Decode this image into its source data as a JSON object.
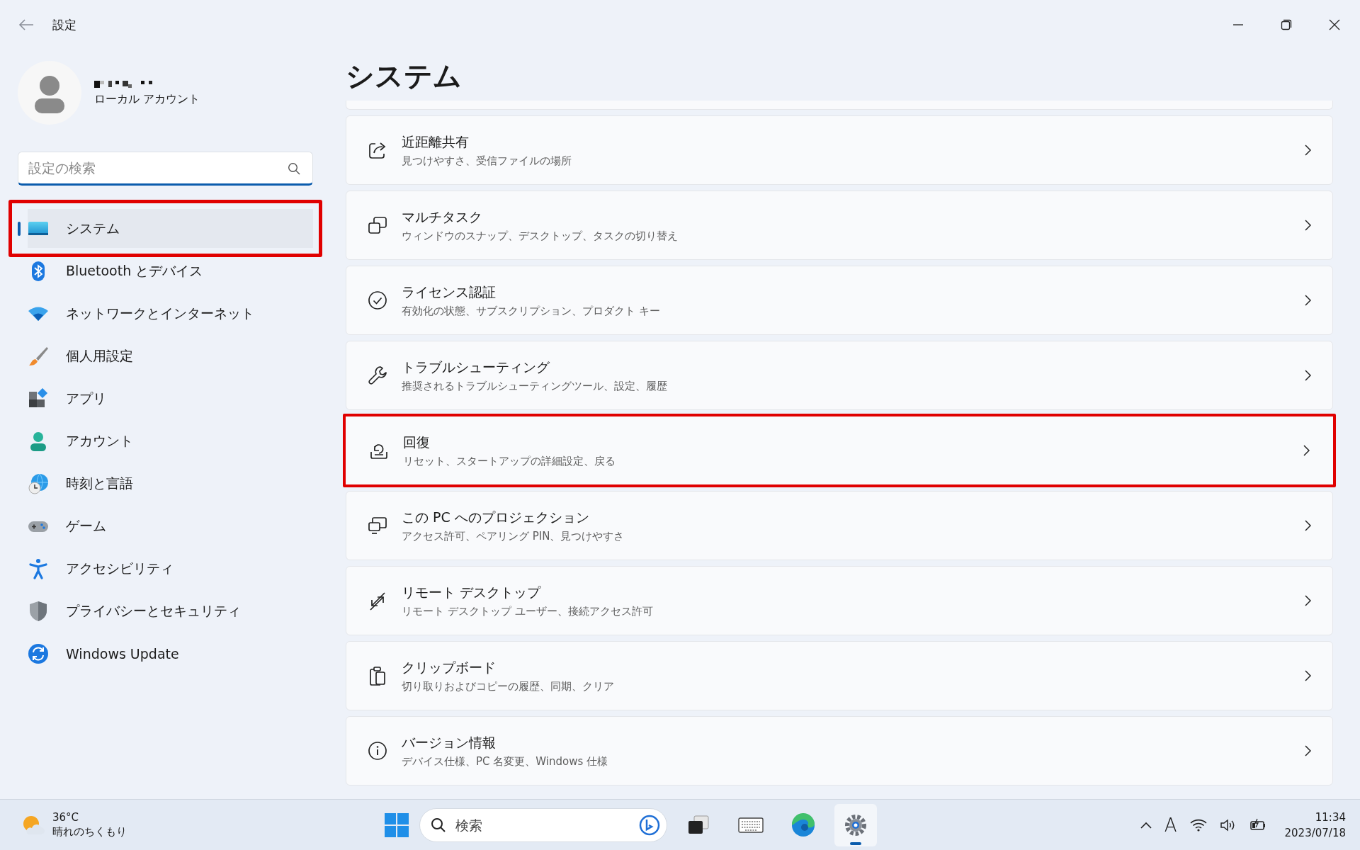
{
  "window": {
    "title": "設定"
  },
  "account": {
    "type": "ローカル アカウント"
  },
  "search": {
    "placeholder": "設定の検索"
  },
  "nav": [
    {
      "label": "システム",
      "kind": "system",
      "selected": true,
      "highlighted": true
    },
    {
      "label": "Bluetooth とデバイス",
      "kind": "bluetooth",
      "selected": false,
      "highlighted": false
    },
    {
      "label": "ネットワークとインターネット",
      "kind": "network",
      "selected": false,
      "highlighted": false
    },
    {
      "label": "個人用設定",
      "kind": "brush",
      "selected": false,
      "highlighted": false
    },
    {
      "label": "アプリ",
      "kind": "apps",
      "selected": false,
      "highlighted": false
    },
    {
      "label": "アカウント",
      "kind": "person",
      "selected": false,
      "highlighted": false
    },
    {
      "label": "時刻と言語",
      "kind": "globe",
      "selected": false,
      "highlighted": false
    },
    {
      "label": "ゲーム",
      "kind": "gamepad",
      "selected": false,
      "highlighted": false
    },
    {
      "label": "アクセシビリティ",
      "kind": "accessibility",
      "selected": false,
      "highlighted": false
    },
    {
      "label": "プライバシーとセキュリティ",
      "kind": "shield",
      "selected": false,
      "highlighted": false
    },
    {
      "label": "Windows Update",
      "kind": "update",
      "selected": false,
      "highlighted": false
    }
  ],
  "page": {
    "title": "システム"
  },
  "cards": [
    {
      "title": "近距離共有",
      "subtitle": "見つけやすさ、受信ファイルの場所",
      "kind": "share",
      "highlighted": false
    },
    {
      "title": "マルチタスク",
      "subtitle": "ウィンドウのスナップ、デスクトップ、タスクの切り替え",
      "kind": "windows",
      "highlighted": false
    },
    {
      "title": "ライセンス認証",
      "subtitle": "有効化の状態、サブスクリプション、プロダクト キー",
      "kind": "check",
      "highlighted": false
    },
    {
      "title": "トラブルシューティング",
      "subtitle": "推奨されるトラブルシューティングツール、設定、履歴",
      "kind": "wrench",
      "highlighted": false
    },
    {
      "title": "回復",
      "subtitle": "リセット、スタートアップの詳細設定、戻る",
      "kind": "recovery",
      "highlighted": true
    },
    {
      "title": "この PC へのプロジェクション",
      "subtitle": "アクセス許可、ペアリング PIN、見つけやすさ",
      "kind": "projection",
      "highlighted": false
    },
    {
      "title": "リモート デスクトップ",
      "subtitle": "リモート デスクトップ ユーザー、接続アクセス許可",
      "kind": "remote",
      "highlighted": false
    },
    {
      "title": "クリップボード",
      "subtitle": "切り取りおよびコピーの履歴、同期、クリア",
      "kind": "clipboard",
      "highlighted": false
    },
    {
      "title": "バージョン情報",
      "subtitle": "デバイス仕様、PC 名変更、Windows 仕様",
      "kind": "info",
      "highlighted": false
    }
  ],
  "taskbar": {
    "weather": {
      "temperature": "36°C",
      "condition": "晴れのちくもり"
    },
    "search": {
      "placeholder": "検索"
    },
    "apps": [
      {
        "kind": "taskview",
        "selected": false
      },
      {
        "kind": "keyboard",
        "selected": false
      },
      {
        "kind": "edge",
        "selected": false
      },
      {
        "kind": "settings",
        "selected": true
      }
    ],
    "ime": "A",
    "time": "11:34",
    "date": "2023/07/18"
  }
}
